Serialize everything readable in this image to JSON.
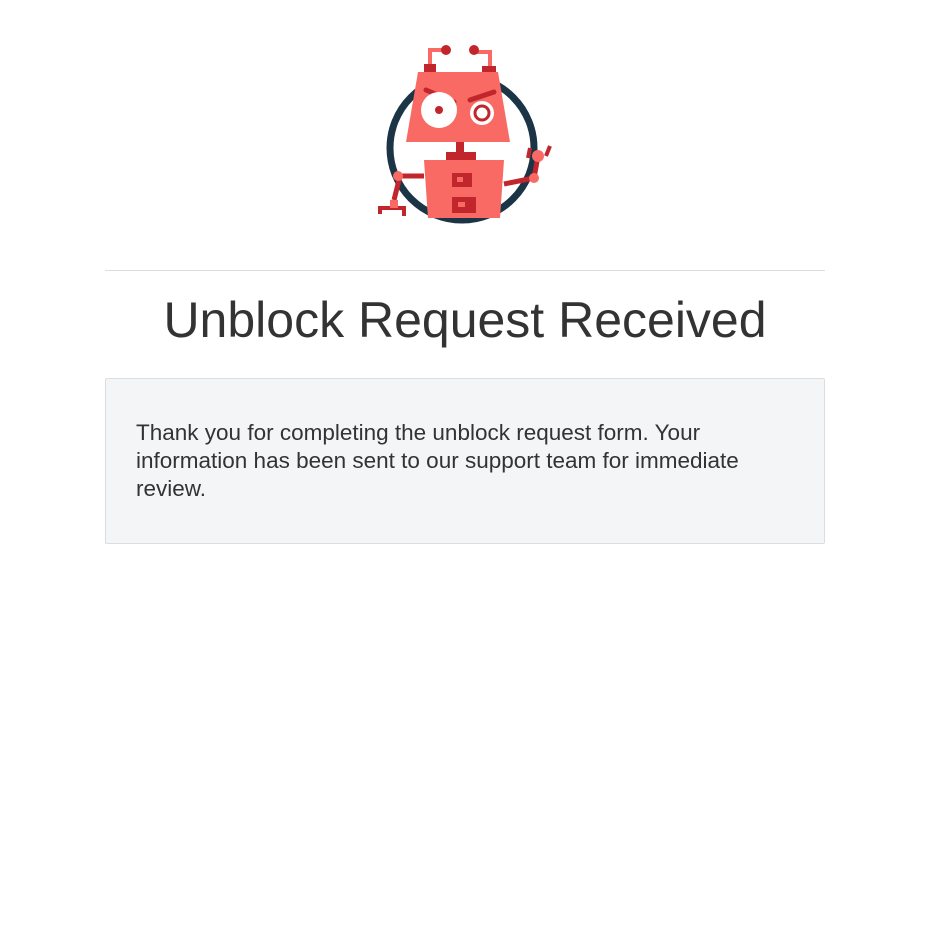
{
  "header": {
    "logo_icon": "angry-robot-logo-icon"
  },
  "main": {
    "title": "Unblock Request Received",
    "message": "Thank you for completing the unblock request form. Your information has been sent to our support team for immediate review."
  },
  "colors": {
    "robot_body": "#f96a64",
    "robot_dark": "#c0262b",
    "ring": "#1b3547",
    "panel_background": "#f4f5f7",
    "divider": "#dddddd",
    "text": "#333333"
  }
}
